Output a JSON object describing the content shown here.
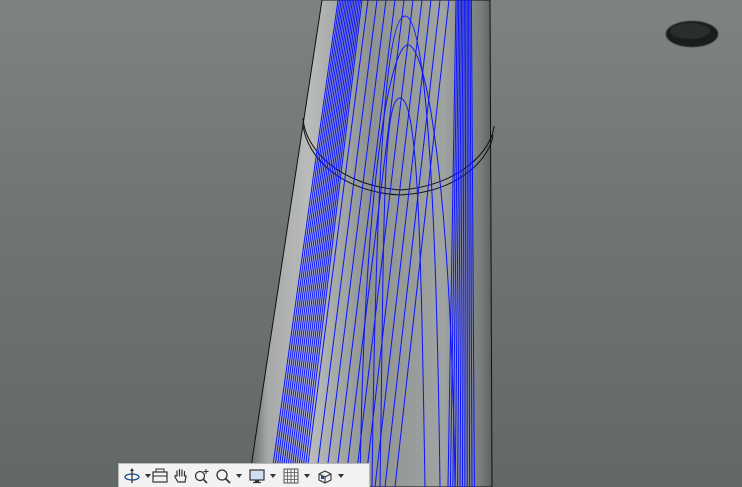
{
  "viewport": {
    "background": "#6f7575",
    "part_color": "#9a9e9c",
    "toolpath_color": "#0a14ff",
    "edge_color": "#111111"
  },
  "toolbar": {
    "buttons": [
      {
        "id": "orbit",
        "icon": "orbit-icon",
        "has_dropdown": true
      },
      {
        "id": "look-at",
        "icon": "look-at-icon",
        "has_dropdown": false
      },
      {
        "id": "pan",
        "icon": "pan-hand-icon",
        "has_dropdown": false
      },
      {
        "id": "zoom",
        "icon": "zoom-icon",
        "has_dropdown": false
      },
      {
        "id": "fit",
        "icon": "zoom-window-icon",
        "has_dropdown": true
      },
      {
        "id": "display-settings",
        "icon": "display-settings-icon",
        "has_dropdown": true
      },
      {
        "id": "grid",
        "icon": "grid-icon",
        "has_dropdown": true
      },
      {
        "id": "multiple-views",
        "icon": "viewcube-icon",
        "has_dropdown": true
      }
    ]
  }
}
